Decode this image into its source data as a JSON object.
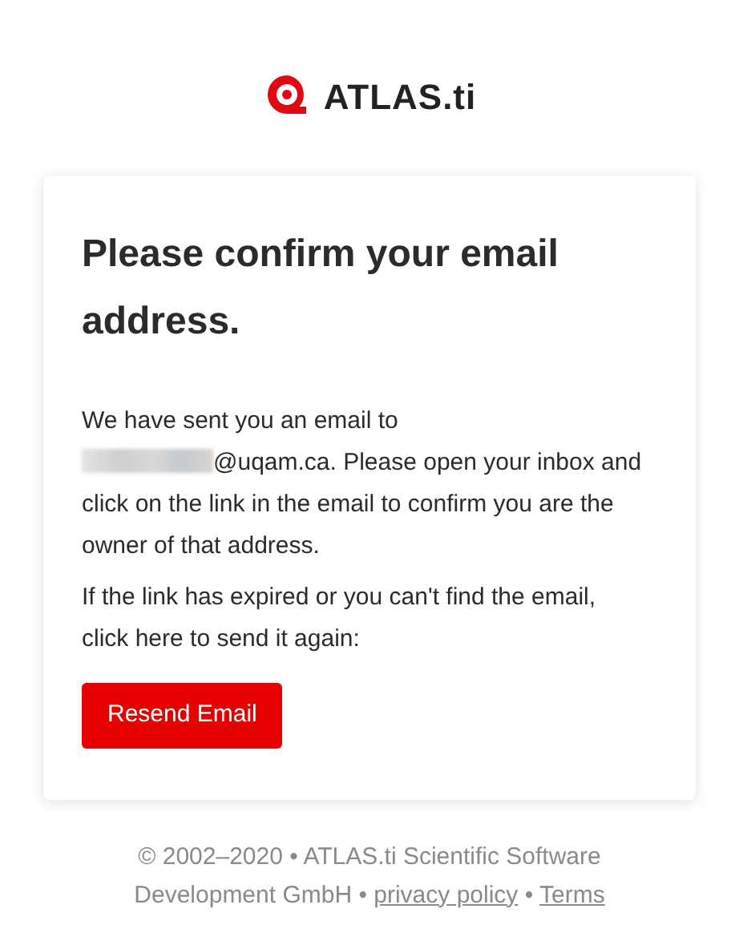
{
  "logo": {
    "text": "ATLAS.ti"
  },
  "card": {
    "title": "Please confirm your email address.",
    "message_start": "We have sent you an email to",
    "message_end": "@uqam.ca. Please open your inbox and click on the link in the email to confirm you are the owner of that address.",
    "resend_hint": "If the link has expired or you can't find the email, click here to send it again:",
    "button": "Resend Email"
  },
  "footer": {
    "text": "© 2002–2020 • ATLAS.ti Scientific Software Development GmbH •",
    "links": [
      {
        "label": "privacy policy"
      },
      {
        "label": "Terms"
      }
    ],
    "separator": "•"
  }
}
